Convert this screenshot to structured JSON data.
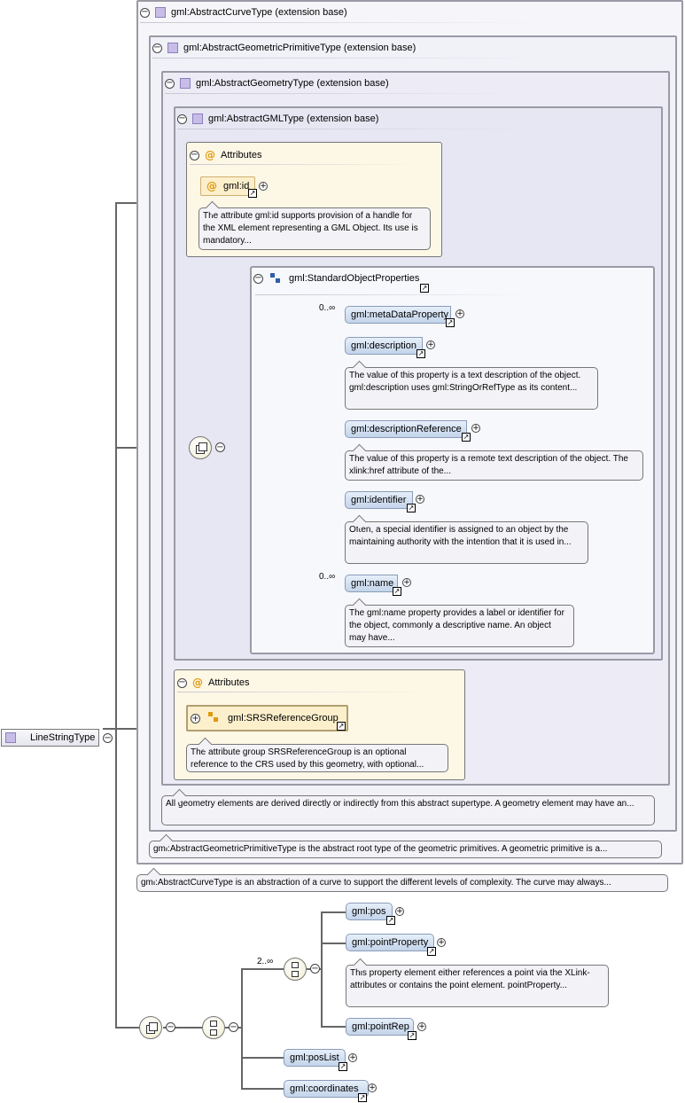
{
  "root": {
    "label": "LineStringType"
  },
  "bases": [
    {
      "label": "gml:AbstractCurveType (extension base)",
      "note": "gml:AbstractCurveType is an abstraction of a curve to support the different levels of complexity. The curve may always..."
    },
    {
      "label": "gml:AbstractGeometricPrimitiveType (extension base)",
      "note": "gml:AbstractGeometricPrimitiveType is the abstract root type of the geometric primitives. A geometric primitive is a..."
    },
    {
      "label": "gml:AbstractGeometryType (extension base)",
      "note": "All geometry elements are derived directly or indirectly from this abstract supertype. A geometry element may have an..."
    },
    {
      "label": "gml:AbstractGMLType (extension base)"
    }
  ],
  "attributes1": {
    "title": "Attributes",
    "id_label": "gml:id",
    "id_note": "The attribute gml:id supports provision of a handle for the XML element representing a GML Object. Its use is mandatory..."
  },
  "std_props": {
    "label": "gml:StandardObjectProperties",
    "items": [
      {
        "label": "gml:metaDataProperty",
        "occ": "0..∞"
      },
      {
        "label": "gml:description",
        "note": "The value of this property is a text description of the object. gml:description uses gml:StringOrRefType as its content..."
      },
      {
        "label": "gml:descriptionReference",
        "note": "The value of this property is a remote text description of the object. The xlink:href attribute of the..."
      },
      {
        "label": "gml:identifier",
        "note": "Often, a special identifier is assigned to an object by the maintaining authority with the intention that it is used in..."
      },
      {
        "label": "gml:name",
        "occ": "0..∞",
        "note": "The gml:name property provides a label or identifier for the object, commonly a descriptive name. An object may have..."
      }
    ]
  },
  "attributes2": {
    "title": "Attributes",
    "group_label": "gml:SRSReferenceGroup",
    "group_note": "The attribute group SRSReferenceGroup is an optional reference to the CRS used by this geometry, with optional..."
  },
  "choice": {
    "occ": "2..∞",
    "items": [
      {
        "label": "gml:pos"
      },
      {
        "label": "gml:pointProperty",
        "note": "This property element either references a point via the XLink-attributes or contains the point element. pointProperty..."
      },
      {
        "label": "gml:pointRep"
      }
    ]
  },
  "seq_items": [
    {
      "label": "gml:posList"
    },
    {
      "label": "gml:coordinates"
    }
  ],
  "colors": {
    "attr_bg": "#fdf7e6",
    "base_bg": "#f1f0f8",
    "std_bg": "#f6f8fc",
    "element_fill": "#c3d4ea"
  }
}
